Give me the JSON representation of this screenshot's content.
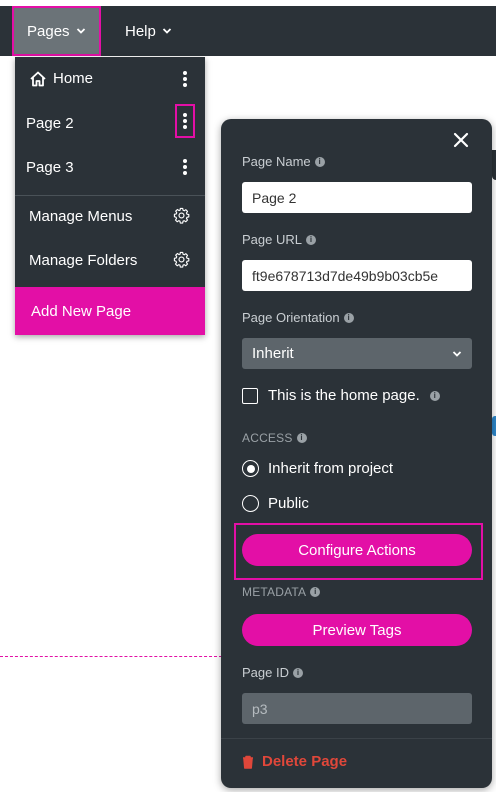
{
  "topbar": {
    "pages_label": "Pages",
    "help_label": "Help"
  },
  "menu": {
    "items": [
      {
        "label": "Home"
      },
      {
        "label": "Page 2"
      },
      {
        "label": "Page 3"
      }
    ],
    "manage_menus": "Manage Menus",
    "manage_folders": "Manage Folders",
    "add_new_page": "Add New Page"
  },
  "panel": {
    "page_name_label": "Page Name",
    "page_name_value": "Page 2",
    "page_url_label": "Page URL",
    "page_url_value": "ft9e678713d7de49b9b03cb5e",
    "orientation_label": "Page Orientation",
    "orientation_value": "Inherit",
    "home_checkbox_label": "This is the home page.",
    "access_label": "ACCESS",
    "access_options": [
      {
        "label": "Inherit from project",
        "selected": true
      },
      {
        "label": "Public",
        "selected": false
      }
    ],
    "configure_actions": "Configure Actions",
    "metadata_label": "METADATA",
    "preview_tags": "Preview Tags",
    "page_id_label": "Page ID",
    "page_id_placeholder": "p3",
    "delete_page": "Delete Page"
  },
  "colors": {
    "accent": "#e30fa6",
    "panel_bg": "#2b3238",
    "danger": "#e0473a"
  },
  "icons": [
    "chevron-down-icon",
    "home-icon",
    "more-vertical-icon",
    "gear-icon",
    "close-icon",
    "info-icon",
    "trash-icon"
  ]
}
